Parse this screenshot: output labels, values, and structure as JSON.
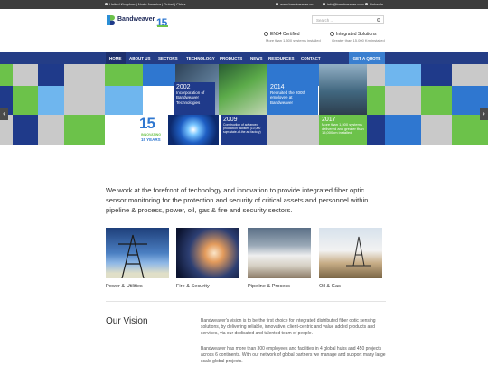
{
  "topbar": {
    "regions": "United Kingdom | North America | Dubai | China",
    "website": "www.bandweaver.cn",
    "email": "info@bandweaver.com",
    "social": "LinkedIn"
  },
  "header": {
    "brand": "Bandweaver",
    "anniversary_badge": "15",
    "search_placeholder": "Search ...",
    "cert1_title": "EN54 Certified",
    "cert1_sub": "More than 1,500 systems installed",
    "cert2_title": "Integrated Solutions",
    "cert2_sub": "Greater than 15,000 Km installed"
  },
  "nav": {
    "items": [
      "HOME",
      "ABOUT US",
      "SECTORS",
      "TECHNOLOGY",
      "PRODUCTS",
      "NEWS",
      "RESOURCES",
      "CONTACT"
    ],
    "cta": "GET A QUOTE"
  },
  "hero": {
    "tiles": [
      {
        "year": "2002",
        "text": "Incorporation of Bandweaver Technologies"
      },
      {
        "year": "2014",
        "text": "Recruited the 200th employee at Bandweaver"
      },
      {
        "year": "2009",
        "text": "Construction of advanced production facilities (10,000 sqm state-of-the art factory)"
      },
      {
        "year": "2017",
        "text": "More than 1,500 systems delivered and greater than 15,000km installed"
      }
    ],
    "badge_number": "15",
    "badge_line1": "INNOVATING",
    "badge_line2": "15 YEARS",
    "prev": "‹",
    "next": "›"
  },
  "intro": "We work at the forefront of technology and innovation to provide integrated fiber optic sensor monitoring for the protection and security of critical assets and personnel within pipeline & process, power, oil, gas & fire and security sectors.",
  "sectors": [
    "Power & Utilities",
    "Fire & Security",
    "Pipeline & Process",
    "Oil & Gas"
  ],
  "vision": {
    "heading": "Our Vision",
    "p1": "Bandweaver's vision is to be the first choice for integrated distributed fiber optic sensing solutions, by delivering reliable, innovative, client-centric and value added products and services, via our dedicated and talented team of people.",
    "p2": "Bandweaver has more than 300 employees and facilities in 4 global hubs and 450 projects across 6 continents. With our network of global partners we manage and support many large scale global projects."
  },
  "colors": {
    "nav": "#243d86",
    "green": "#6cc24a",
    "blue": "#2f77d0",
    "navy": "#1f3a8a",
    "light_blue": "#6fb6ee",
    "gray": "#c8c8c8"
  }
}
